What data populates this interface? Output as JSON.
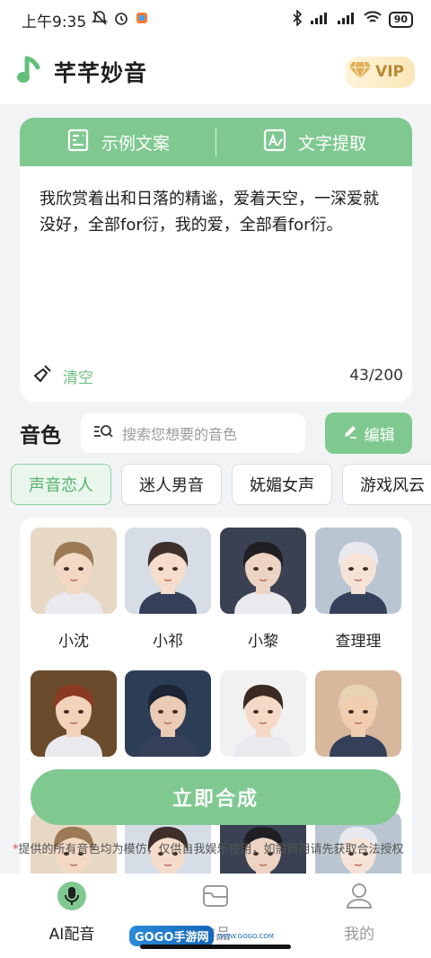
{
  "status_bar": {
    "time": "上午9:35",
    "battery": "90"
  },
  "header": {
    "app_title": "芊芊妙音",
    "vip_label": "VIP"
  },
  "text_card": {
    "tabs": [
      {
        "label": "示例文案",
        "icon": "document-icon"
      },
      {
        "label": "文字提取",
        "icon": "text-extract-icon"
      }
    ],
    "content": "我欣赏着出和日落的精谧，爱着天空，一深爱就没好，全部for衍，我的爱，全部看for衍。",
    "clear_label": "清空",
    "char_count": "43/200"
  },
  "voice": {
    "title": "音色",
    "search_placeholder": "搜索您想要的音色",
    "edit_label": "编辑"
  },
  "categories": [
    {
      "label": "声音恋人",
      "active": true
    },
    {
      "label": "迷人男音",
      "active": false
    },
    {
      "label": "妩媚女声",
      "active": false
    },
    {
      "label": "游戏风云",
      "active": false
    }
  ],
  "voices": [
    {
      "name": "小沈",
      "hair": "#9b7a55",
      "bg": "#e7d8c6"
    },
    {
      "name": "小祁",
      "hair": "#3e2f2a",
      "bg": "#d7dde6"
    },
    {
      "name": "小黎",
      "hair": "#1f1f24",
      "bg": "#3a4152"
    },
    {
      "name": "查理理",
      "hair": "#e8e8ef",
      "bg": "#b9c6d1"
    },
    {
      "name": "",
      "hair": "#8a3a22",
      "bg": "#6a4b2c"
    },
    {
      "name": "",
      "hair": "#1c2333",
      "bg": "#2c3d56"
    },
    {
      "name": "",
      "hair": "#3a2a22",
      "bg": "#f1f1f1"
    },
    {
      "name": "",
      "hair": "#e7d2b3",
      "bg": "#d7b89d"
    }
  ],
  "synthesize_label": "立即合成",
  "disclaimer": "提供的所有音色均为模仿，仅供自我娱乐使用，如需商用请先获取合法授权",
  "bottom_nav": [
    {
      "label": "AI配音",
      "icon": "microphone-icon",
      "active": true
    },
    {
      "label": "作品",
      "icon": "folder-icon",
      "active": false
    },
    {
      "label": "我的",
      "icon": "user-icon",
      "active": false
    }
  ],
  "watermark": {
    "brand": "GOGO手游网",
    "sub": "WWW.GOGO.COM"
  }
}
